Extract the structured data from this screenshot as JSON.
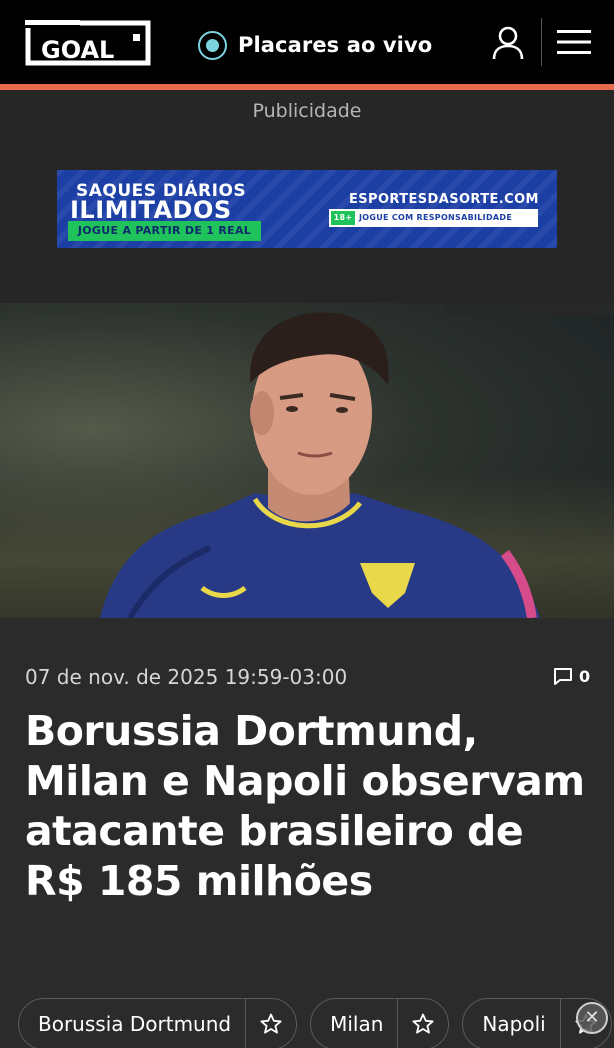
{
  "header": {
    "logo_text": "GOAL",
    "live_scores_label": "Placares ao vivo",
    "icons": [
      "live-dot-icon",
      "user-icon",
      "menu-icon"
    ],
    "accent_color": "#e86a4c"
  },
  "ad": {
    "label": "Publicidade",
    "banner": {
      "line1": "SAQUES DIÁRIOS",
      "line2": "ILIMITADOS",
      "cta": "JOGUE A PARTIR DE 1 REAL",
      "brand": "ESPORTESDASORTE.COM",
      "age": "18+",
      "responsibility": "JOGUE COM RESPONSABILIDADE"
    }
  },
  "article": {
    "date": "07 de nov. de 2025 19:59-03:00",
    "comment_count": "0",
    "headline": "Borussia Dortmund, Milan e Napoli observam atacante brasileiro de R$ 185 milhões",
    "tags": [
      {
        "name": "Borussia Dortmund"
      },
      {
        "name": "Milan"
      },
      {
        "name": "Napoli"
      }
    ]
  }
}
